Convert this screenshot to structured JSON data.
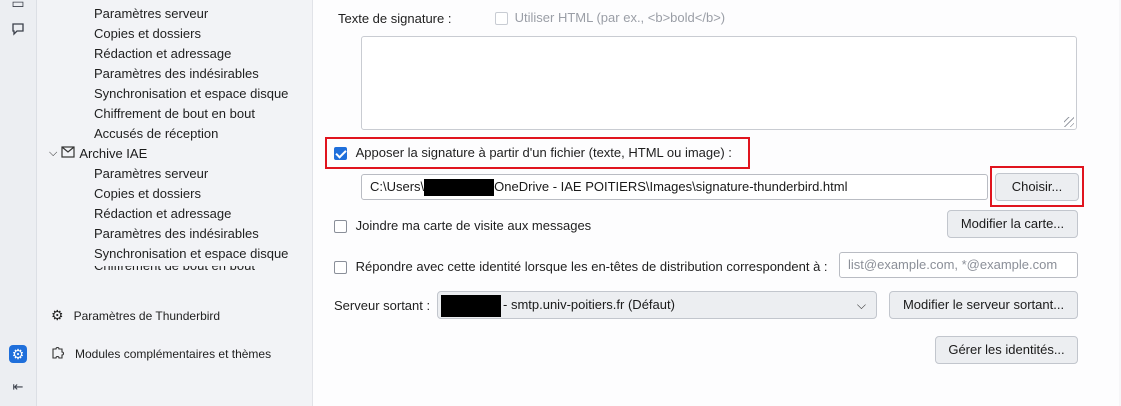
{
  "sidebar": {
    "account1_items": [
      "Paramètres serveur",
      "Copies et dossiers",
      "Rédaction et adressage",
      "Paramètres des indésirables",
      "Synchronisation et espace disque",
      "Chiffrement de bout en bout",
      "Accusés de réception"
    ],
    "account2_name": "Archive IAE",
    "account2_items": [
      "Paramètres serveur",
      "Copies et dossiers",
      "Rédaction et adressage",
      "Paramètres des indésirables",
      "Synchronisation et espace disque",
      "Chiffrement de bout en bout"
    ],
    "thunderbird_settings": "Paramètres de Thunderbird",
    "addons": "Modules complémentaires et thèmes"
  },
  "main": {
    "signature_label": "Texte de signature :",
    "use_html_label": "Utiliser HTML (par ex., <b>bold</b>)",
    "attach_sig_label": "Apposer la signature à partir d'un fichier (texte, HTML ou image) :",
    "file_path_prefix": "C:\\Users\\",
    "file_path_suffix": "OneDrive - IAE POITIERS\\Images\\signature-thunderbird.html",
    "choose_button": "Choisir...",
    "vcard_label": "Joindre ma carte de visite aux messages",
    "edit_card_button": "Modifier la carte...",
    "reply_identity_label": "Répondre avec cette identité lorsque les en-têtes de distribution correspondent à :",
    "reply_identity_placeholder": "list@example.com, *@example.com",
    "smtp_label": "Serveur sortant :",
    "smtp_value": "- smtp.univ-poitiers.fr (Défaut)",
    "edit_smtp_button": "Modifier le serveur sortant...",
    "manage_identities_button": "Gérer les identités..."
  },
  "state": {
    "use_html_checked": false,
    "attach_sig_checked": true,
    "vcard_checked": false,
    "reply_identity_checked": false
  },
  "colors": {
    "accent": "#1f6fdb",
    "highlight": "#e0141e"
  }
}
